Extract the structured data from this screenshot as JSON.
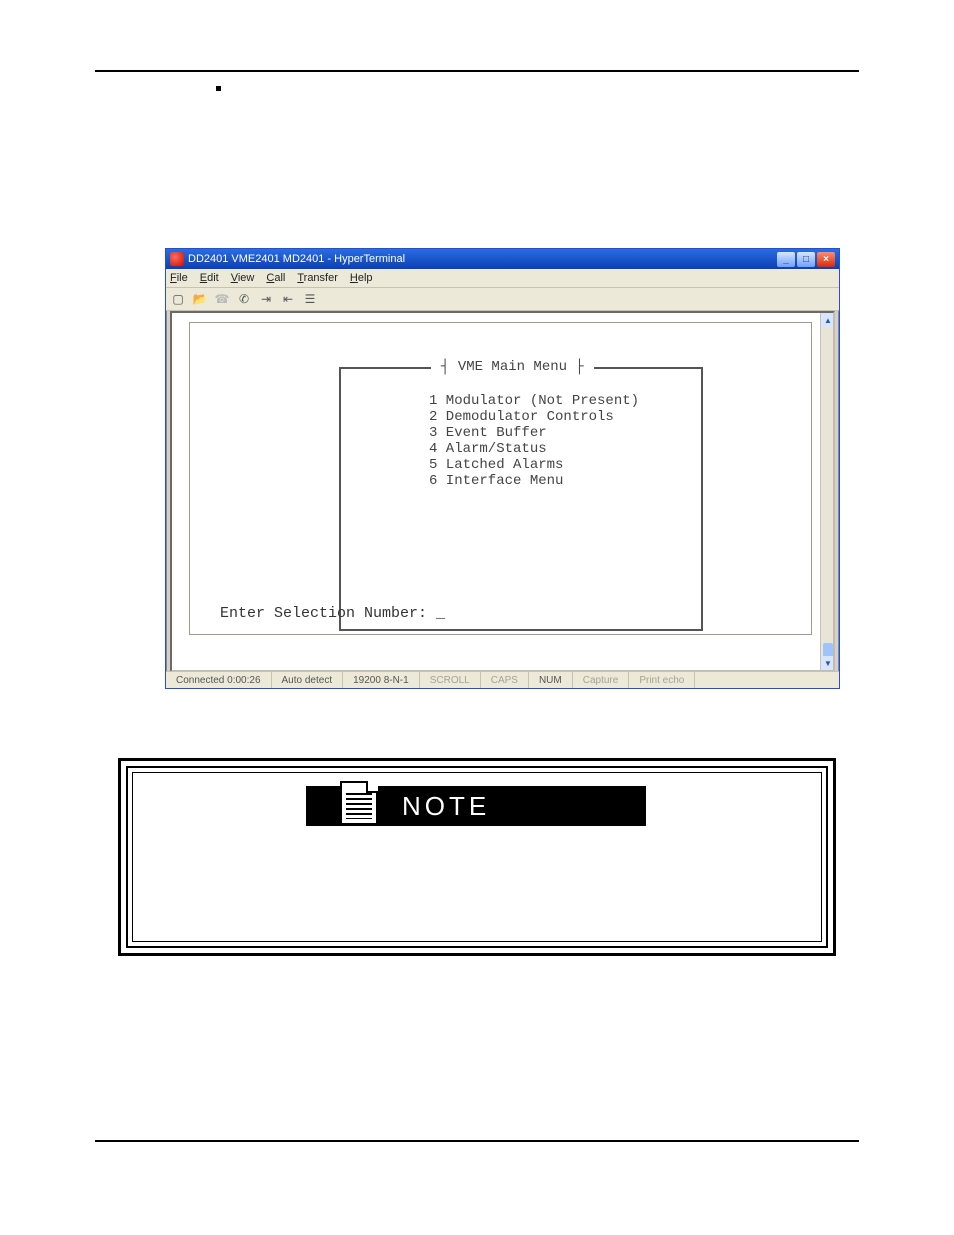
{
  "window": {
    "title": "DD2401 VME2401 MD2401 - HyperTerminal",
    "menus": {
      "file": "File",
      "edit": "Edit",
      "view": "View",
      "call": "Call",
      "transfer": "Transfer",
      "help": "Help"
    }
  },
  "toolbar_icons": [
    "new-doc",
    "open",
    "phone",
    "hangup",
    "send",
    "receive",
    "properties"
  ],
  "terminal": {
    "box_title": "VME Main Menu",
    "items": [
      "1 Modulator (Not Present)",
      "2 Demodulator Controls",
      "3 Event Buffer",
      "4 Alarm/Status",
      "5 Latched Alarms",
      "6 Interface Menu"
    ],
    "prompt": "Enter Selection Number: _"
  },
  "statusbar": {
    "connected": "Connected 0:00:26",
    "detect": "Auto detect",
    "serial": "19200 8-N-1",
    "scroll": "SCROLL",
    "caps": "CAPS",
    "num": "NUM",
    "capture": "Capture",
    "echo": "Print echo"
  },
  "note": {
    "label": "NOTE"
  }
}
